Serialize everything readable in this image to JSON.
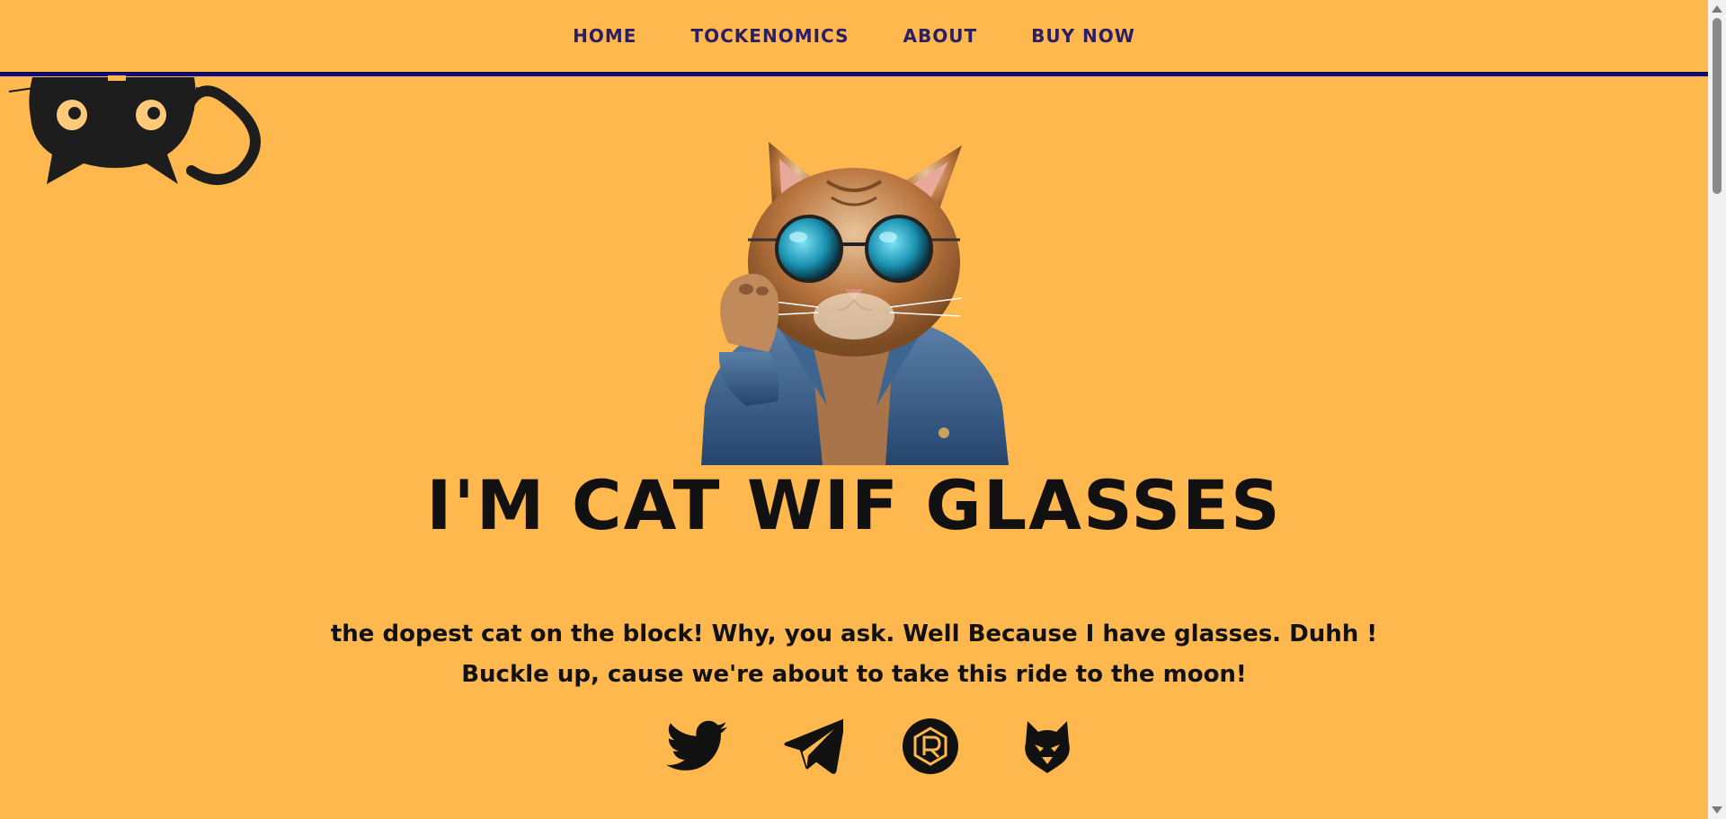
{
  "nav": {
    "items": [
      {
        "label": "HOME"
      },
      {
        "label": "TOCKENOMICS"
      },
      {
        "label": "ABOUT"
      },
      {
        "label": "BUY NOW"
      }
    ]
  },
  "hero": {
    "title": "I'M CAT WIF GLASSES",
    "description": "the dopest cat on the block! Why, you ask. Well Because I have glasses. Duhh ! Buckle up, cause we're about to take this ride to the moon!"
  },
  "socials": [
    {
      "icon": "twitter-icon"
    },
    {
      "icon": "telegram-icon"
    },
    {
      "icon": "raydium-icon"
    },
    {
      "icon": "dexscreener-icon"
    }
  ],
  "colors": {
    "background": "#FFB84D",
    "nav_text": "#2A1E66",
    "nav_line": "#0A0A8A",
    "text": "#111111"
  }
}
